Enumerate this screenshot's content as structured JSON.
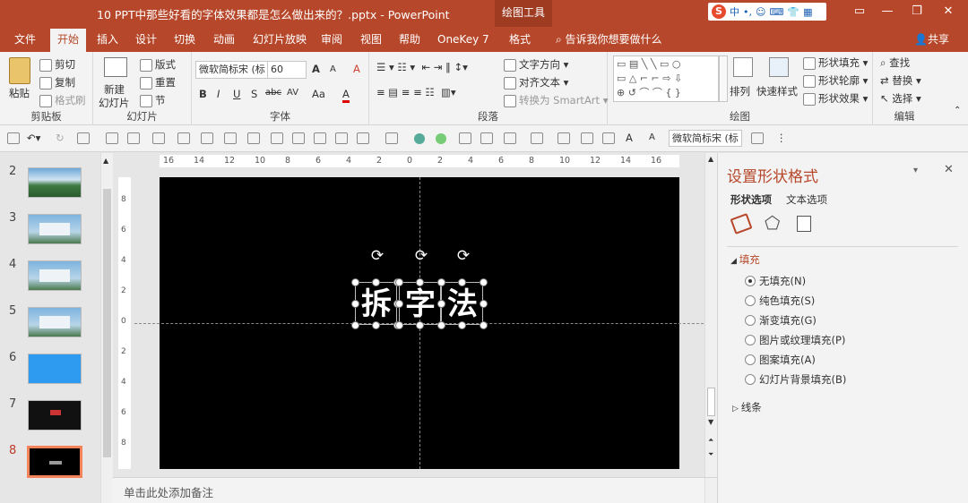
{
  "window": {
    "title": "10 PPT中那些好看的字体效果都是怎么做出来的？.pptx  -  PowerPoint",
    "context_tab": "绘图工具",
    "ime": {
      "logo": "S",
      "items": [
        "中",
        "•,",
        "☺",
        "⌨",
        "👕",
        "▦"
      ]
    },
    "controls": {
      "ribbon_display": "▭",
      "minimize": "—",
      "restore": "❐",
      "close": "✕"
    }
  },
  "tabs": [
    "文件",
    "开始",
    "插入",
    "设计",
    "切换",
    "动画",
    "幻灯片放映",
    "审阅",
    "视图",
    "帮助",
    "OneKey 7",
    "格式"
  ],
  "active_tab": "开始",
  "tell_me": "告诉我你想要做什么",
  "share": "共享",
  "ribbon": {
    "clipboard": {
      "label": "剪贴板",
      "paste": "粘贴",
      "cut": "剪切",
      "copy": "复制",
      "format_painter": "格式刷"
    },
    "slides": {
      "label": "幻灯片",
      "new_slide": "新建",
      "new_slide2": "幻灯片",
      "layout": "版式",
      "reset": "重置",
      "section": "节"
    },
    "font": {
      "label": "字体",
      "family": "微软简标宋 (标",
      "size": "60",
      "grow": "A",
      "shrink": "A",
      "clear": "A",
      "bold": "B",
      "italic": "I",
      "underline": "U",
      "shadow": "S",
      "strike": "abc",
      "spacing": "AV",
      "case": "Aa",
      "color": "A"
    },
    "paragraph": {
      "label": "段落",
      "text_direction": "文字方向",
      "align_text": "对齐文本",
      "smartart": "转换为 SmartArt"
    },
    "drawing": {
      "label": "绘图",
      "arrange": "排列",
      "quick_styles": "快速样式",
      "fill": "形状填充",
      "outline": "形状轮廓",
      "effects": "形状效果"
    },
    "editing": {
      "label": "编辑",
      "find": "查找",
      "replace": "替换",
      "select": "选择"
    }
  },
  "qat": {
    "font": "微软简标宋 (标"
  },
  "ruler": {
    "h_labels": [
      "16",
      "14",
      "12",
      "10",
      "8",
      "6",
      "4",
      "2",
      "0",
      "2",
      "4",
      "6",
      "8",
      "10",
      "12",
      "14",
      "16"
    ],
    "v_labels": [
      "8",
      "6",
      "4",
      "2",
      "0",
      "2",
      "4",
      "6",
      "8"
    ]
  },
  "slides": [
    {
      "num": "2",
      "kind": "landscape"
    },
    {
      "num": "3",
      "kind": "card"
    },
    {
      "num": "4",
      "kind": "card"
    },
    {
      "num": "5",
      "kind": "card"
    },
    {
      "num": "6",
      "kind": "blue"
    },
    {
      "num": "7",
      "kind": "dark"
    },
    {
      "num": "8",
      "kind": "black",
      "selected": true
    }
  ],
  "slide_canvas": {
    "background": "#000000",
    "chars": [
      "拆",
      "字",
      "法"
    ]
  },
  "notes_placeholder": "单击此处添加备注",
  "format_pane": {
    "title": "设置形状格式",
    "tabs": [
      "形状选项",
      "文本选项"
    ],
    "fill_section": "填充",
    "fill_options": [
      "无填充(N)",
      "纯色填充(S)",
      "渐变填充(G)",
      "图片或纹理填充(P)",
      "图案填充(A)",
      "幻灯片背景填充(B)"
    ],
    "fill_selected": "无填充(N)",
    "line_section": "线条"
  },
  "colors": {
    "accent": "#b7472a",
    "pane_title": "#b7472a"
  }
}
